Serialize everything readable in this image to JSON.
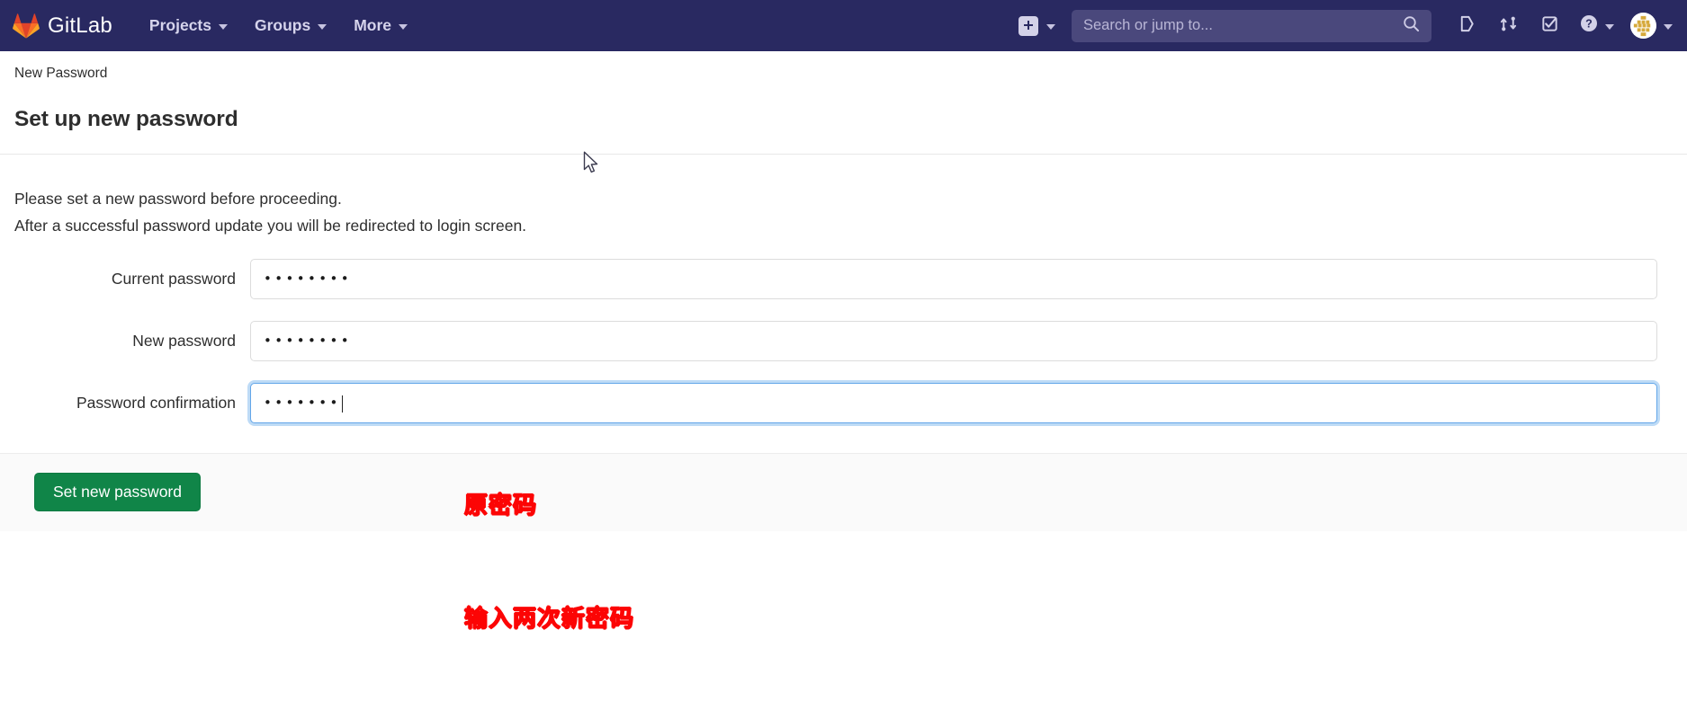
{
  "navbar": {
    "brand": "GitLab",
    "brand_logo_icon": "gitlab-tanuki-logo",
    "links": [
      {
        "label": "Projects",
        "icon": "chevron-down-icon"
      },
      {
        "label": "Groups",
        "icon": "chevron-down-icon"
      },
      {
        "label": "More",
        "icon": "chevron-down-icon"
      }
    ],
    "create_new": {
      "icon": "plus-square-icon",
      "caret_icon": "chevron-down-icon"
    },
    "search": {
      "placeholder": "Search or jump to...",
      "value": "",
      "icon": "search-icon"
    },
    "icons": [
      {
        "name": "issues-icon"
      },
      {
        "name": "merge-requests-icon"
      },
      {
        "name": "todos-icon"
      },
      {
        "name": "help-icon"
      }
    ],
    "avatar": {
      "icon": "user-avatar-identicon"
    },
    "colors": {
      "background": "#292961",
      "search_background": "#4a487c",
      "link_text": "#d6d4ec"
    }
  },
  "breadcrumb": {
    "text": "New Password"
  },
  "page": {
    "title": "Set up new password",
    "lead_line_1": "Please set a new password before proceeding.",
    "lead_line_2": "After a successful password update you will be redirected to login screen."
  },
  "form": {
    "fields": [
      {
        "label": "Current password",
        "value": "••••••••",
        "masked_char_count": 8,
        "focused": false,
        "name": "current-password-input"
      },
      {
        "label": "New password",
        "value": "••••••••",
        "masked_char_count": 8,
        "focused": false,
        "name": "new-password-input"
      },
      {
        "label": "Password confirmation",
        "value": "•••••••",
        "masked_char_count": 7,
        "focused": true,
        "name": "password-confirmation-input"
      }
    ],
    "submit_label": "Set new password",
    "submit_color": "#108548"
  },
  "annotations": [
    {
      "text": "原密码",
      "color": "#fc0505",
      "target": "current-password"
    },
    {
      "text": "输入两次新密码",
      "color": "#fc0505",
      "target": "new-and-confirm-password"
    }
  ]
}
